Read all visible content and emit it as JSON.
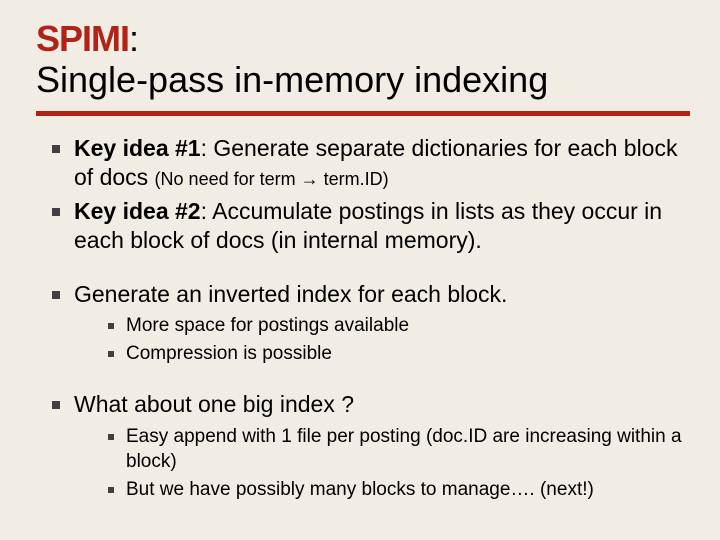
{
  "title": {
    "spimi": "SPIMI",
    "rest1": ":",
    "line2": "Single-pass in-memory indexing"
  },
  "bullets": {
    "b1_lead": "Key idea #1",
    "b1_rest": ": Generate separate dictionaries for each block of docs ",
    "b1_paren": "(No need for term → term.ID)",
    "b2_lead": "Key idea #2",
    "b2_rest": ": Accumulate postings in lists as they occur in each block of docs (in internal memory).",
    "b3": "Generate an inverted index for each block.",
    "b3_sub1": "More space for postings available",
    "b3_sub2": "Compression is possible",
    "b4": "What about one big index ?",
    "b4_sub1": "Easy append with 1 file per posting (doc.ID are increasing within a block)",
    "b4_sub2": "But we have possibly many blocks to manage…. (next!)"
  }
}
